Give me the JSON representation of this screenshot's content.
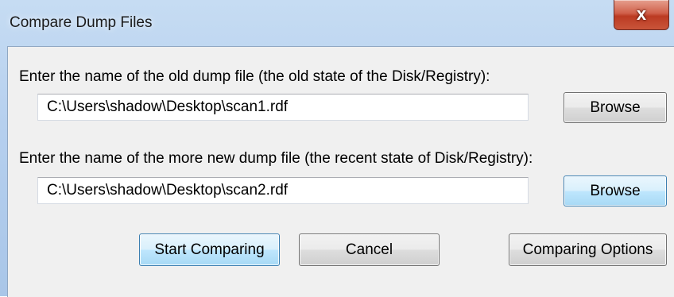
{
  "window": {
    "title": "Compare Dump Files",
    "close_label": "x"
  },
  "old_dump": {
    "label": "Enter the name of the old dump file (the old state of the Disk/Registry):",
    "value": "C:\\Users\\shadow\\Desktop\\scan1.rdf",
    "browse_label": "Browse"
  },
  "new_dump": {
    "label": "Enter the name of the more new dump file (the recent state of Disk/Registry):",
    "value": "C:\\Users\\shadow\\Desktop\\scan2.rdf",
    "browse_label": "Browse"
  },
  "actions": {
    "start_label": "Start Comparing",
    "cancel_label": "Cancel",
    "options_label": "Comparing Options"
  }
}
